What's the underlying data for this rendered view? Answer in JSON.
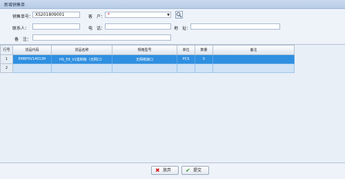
{
  "window": {
    "title": "新增销售单"
  },
  "form": {
    "order_no": {
      "label": "销售单号：",
      "value": "XS201809001"
    },
    "customer": {
      "label": "客　户：",
      "value": "*"
    },
    "contact": {
      "label": "联系人：",
      "value": ""
    },
    "phone": {
      "label": "电　话：",
      "value": ""
    },
    "address": {
      "label": "地　址：",
      "value": ""
    },
    "remark": {
      "label": "备　注：",
      "value": ""
    }
  },
  "grid": {
    "columns": [
      "行号",
      "货品代码",
      "货品名称",
      "规格型号",
      "单位",
      "数量",
      "备注"
    ],
    "rows": [
      {
        "num": "1",
        "code": "EMBF0V14013H",
        "name": "HS_E9_V2盒制板（无网口）",
        "spec": "无网络接口",
        "unit": "PCS",
        "qty": "5",
        "note": ""
      },
      {
        "num": "2",
        "code": "",
        "name": "",
        "spec": "",
        "unit": "",
        "qty": "",
        "note": ""
      }
    ]
  },
  "buttons": {
    "cancel": {
      "label": "放弃",
      "icon": "x-icon",
      "color": "#d11c1c"
    },
    "submit": {
      "label": "提交",
      "icon": "check-icon",
      "color": "#2a9a2a"
    }
  },
  "colors": {
    "selected_row": "#2f8fe0",
    "empty_row": "#cfe3f6"
  }
}
